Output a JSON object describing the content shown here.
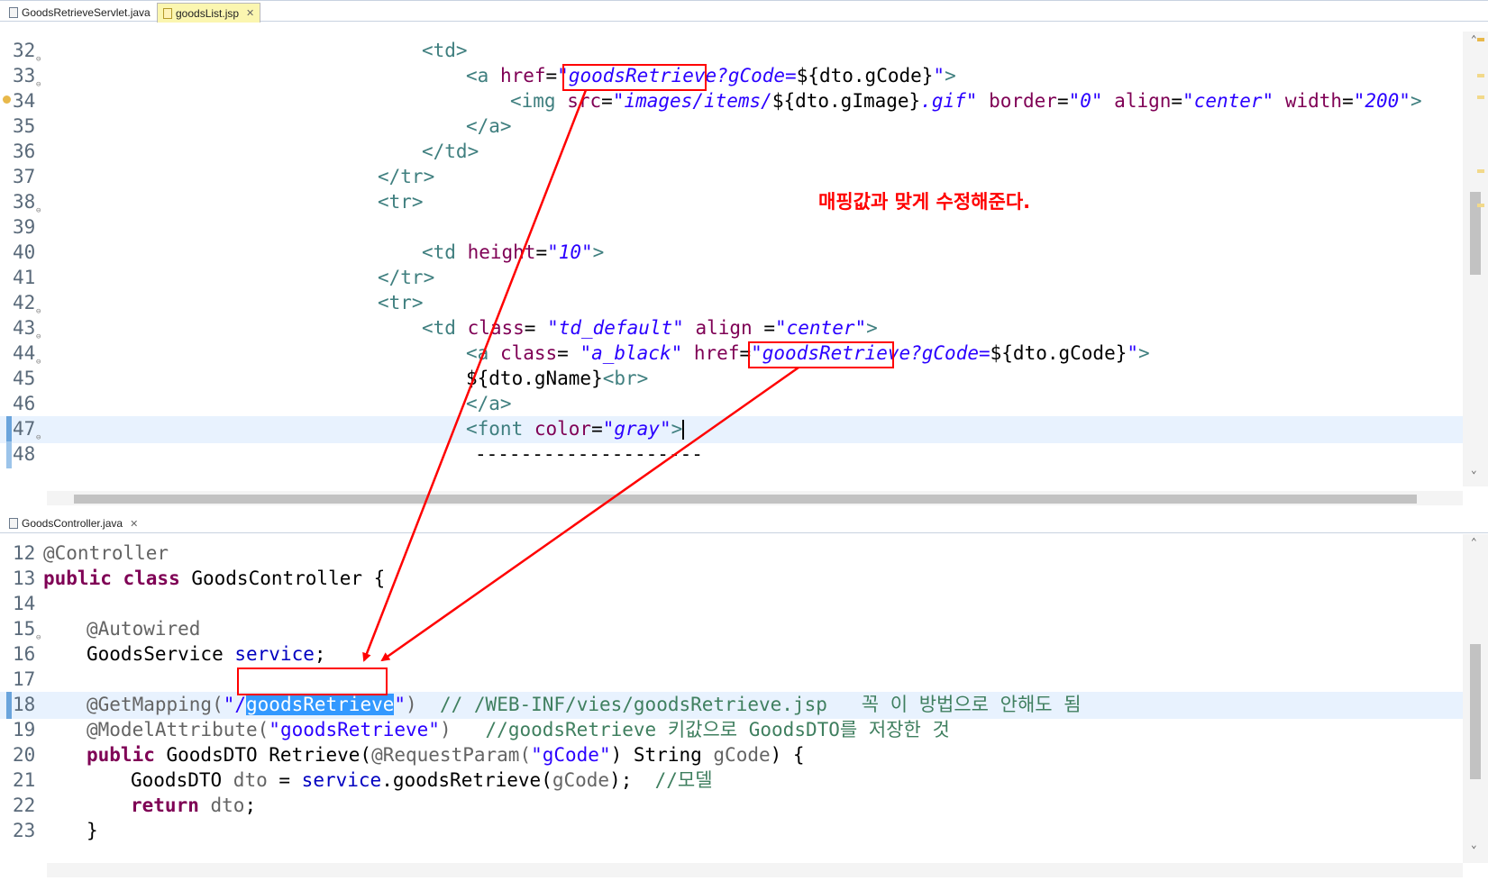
{
  "tabs_top": [
    {
      "label": "GoodsRetrieveServlet.java",
      "active": false
    },
    {
      "label": "goodsList.jsp",
      "active": true
    }
  ],
  "tabs_bottom": [
    {
      "label": "GoodsController.java",
      "active": true
    }
  ],
  "close_glyph": "✕",
  "top_lines": {
    "n32": "32",
    "n33": "33",
    "n34": "34",
    "n35": "35",
    "n36": "36",
    "n37": "37",
    "n38": "38",
    "n39": "39",
    "n40": "40",
    "n41": "41",
    "n42": "42",
    "n43": "43",
    "n44": "44",
    "n45": "45",
    "n46": "46",
    "n47": "47",
    "n48": "48",
    "l32": "<td>",
    "l33a": "<a ",
    "l33b": "href",
    "l33c": "=",
    "l33d": "\"goodsRetrieve?gCode=",
    "l33e": "${dto.gCode}",
    "l33f": "\"",
    "l33g": ">",
    "l34a": "<img ",
    "l34b": "src",
    "l34c": "=",
    "l34d": "\"images/items/",
    "l34e": "${dto.gImage}",
    "l34f": ".gif\"",
    "l34g": " border",
    "l34h": "=",
    "l34i": "\"0\"",
    "l34j": " align",
    "l34k": "=",
    "l34l": "\"center\"",
    "l34m": " width",
    "l34n": "=",
    "l34o": "\"200\"",
    "l34p": ">",
    "l35": "</a>",
    "l36": "</td>",
    "l37": "</tr>",
    "l38": "<tr>",
    "l40a": "<td ",
    "l40b": "height",
    "l40c": "=",
    "l40d": "\"10\"",
    "l40e": ">",
    "l41": "</tr>",
    "l42": "<tr>",
    "l43a": "<td ",
    "l43b": "class",
    "l43c": "= ",
    "l43d": "\"td_default\"",
    "l43e": " align ",
    "l43f": "=",
    "l43g": "\"center\"",
    "l43h": ">",
    "l44a": "<a ",
    "l44b": "class",
    "l44c": "= ",
    "l44d": "\"a_black\"",
    "l44e": " href",
    "l44f": "=",
    "l44g": "\"goodsRetrieve?gCode=",
    "l44h": "${dto.gCode}",
    "l44i": "\"",
    "l44j": ">",
    "l45a": "${dto.gName}",
    "l45b": "<br>",
    "l46": "</a>",
    "l47a": "<font ",
    "l47b": "color",
    "l47c": "=",
    "l47d": "\"gray\"",
    "l47e": ">",
    "l48": "--------------------"
  },
  "bottom_lines": {
    "n12": "12",
    "n13": "13",
    "n14": "14",
    "n15": "15",
    "n16": "16",
    "n17": "17",
    "n18": "18",
    "n19": "19",
    "n20": "20",
    "n21": "21",
    "n22": "22",
    "n23": "23",
    "l12": "@Controller",
    "l13a": "public class",
    "l13b": " GoodsController {",
    "l15": "@Autowired",
    "l16a": "GoodsService ",
    "l16b": "service",
    "l16c": ";",
    "l18a": "@GetMapping(",
    "l18b": "\"/",
    "l18c": "goodsRetrieve",
    "l18d": "\"",
    "l18e": ")  ",
    "l18f": "// /WEB-INF/vies/goodsRetrieve.jsp   꼭 이 방법으로 안해도 됨",
    "l19a": "@ModelAttribute(",
    "l19b": "\"goodsRetrieve\"",
    "l19c": ")   ",
    "l19d": "//goodsRetrieve 키값으로 GoodsDTO를 저장한 것",
    "l20a": "public",
    "l20b": " GoodsDTO Retrieve(",
    "l20c": "@RequestParam(",
    "l20d": "\"gCode\"",
    "l20e": ") String ",
    "l20f": "gCode",
    "l20g": ") {",
    "l21a": "GoodsDTO ",
    "l21b": "dto",
    "l21c": " = ",
    "l21d": "service",
    "l21e": ".goodsRetrieve(",
    "l21f": "gCode",
    "l21g": ");  ",
    "l21h": "//모델",
    "l22a": "return",
    "l22b": " dto",
    "l22c": ";",
    "l23": "}"
  },
  "annotation": "매핑값과 맞게 수정해준다.",
  "colors": {
    "annotation": "#ff0000",
    "selection": "#3399ff",
    "current_line": "#e8f2fe"
  }
}
